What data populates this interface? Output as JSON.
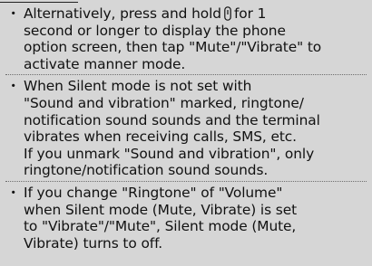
{
  "bullet": "・",
  "notes": [
    {
      "lines": [
        {
          "before": "Alternatively, press and hold",
          "after": "for 1"
        },
        "second or longer to display the phone",
        "option screen, then tap \"Mute\"/\"Vibrate\" to",
        "activate manner mode."
      ]
    },
    {
      "lines": [
        "When Silent mode is not set with",
        "\"Sound and vibration\" marked, ringtone/",
        "notification sound sounds and the terminal",
        "vibrates when receiving calls, SMS, etc.",
        "If you unmark \"Sound and vibration\", only",
        "ringtone/notification sound sounds."
      ]
    },
    {
      "lines": [
        "If you change \"Ringtone\" of \"Volume\"",
        "when Silent mode (Mute, Vibrate) is set",
        "to \"Vibrate\"/\"Mute\", Silent mode (Mute,",
        "Vibrate) turns to off."
      ]
    }
  ],
  "icons": {
    "power_key": "power-key-icon"
  },
  "colors": {
    "background": "#d6d6d6",
    "text": "#111111",
    "separator": "#6e6e6e"
  }
}
